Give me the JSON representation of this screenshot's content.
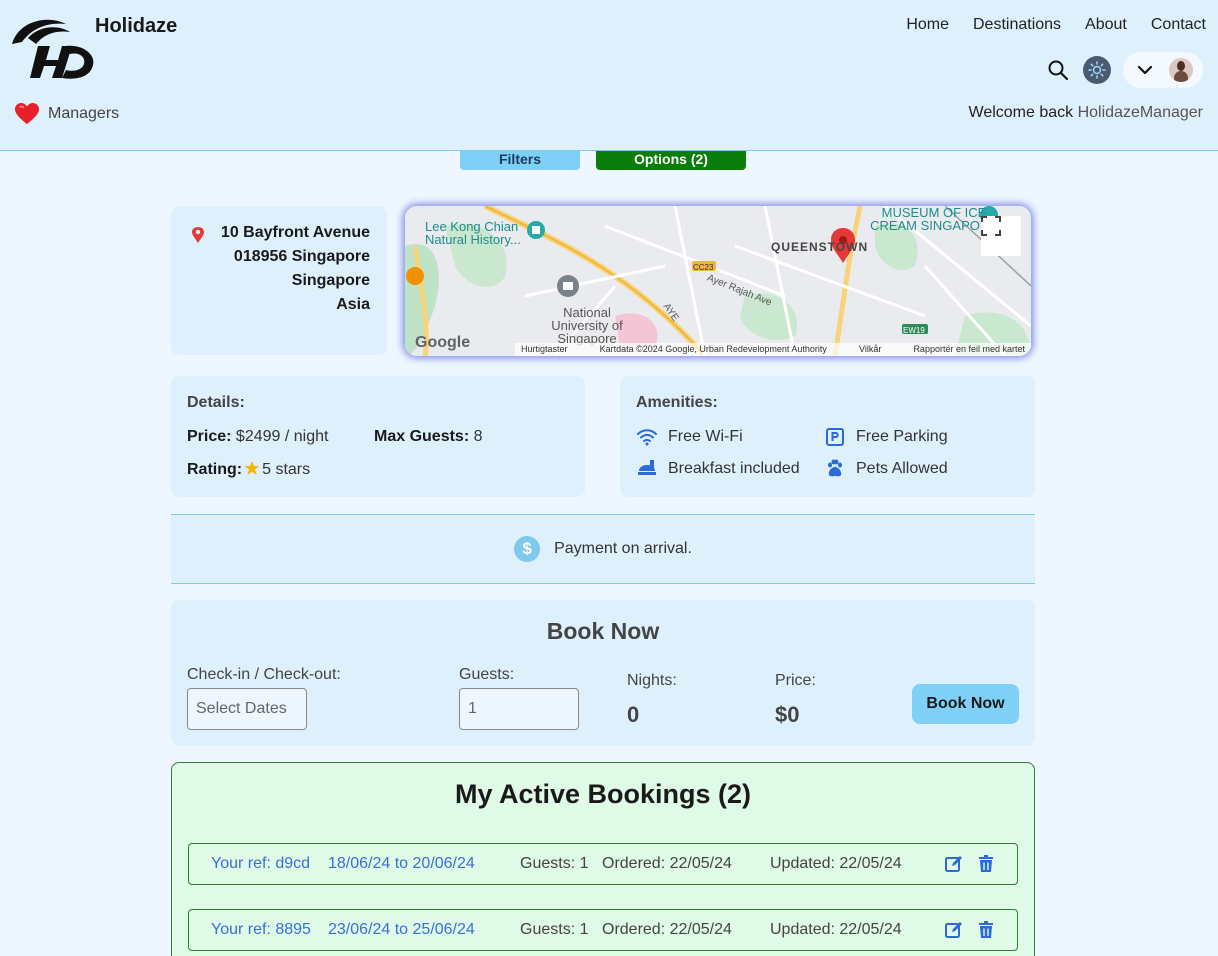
{
  "header": {
    "brand": "Holidaze",
    "nav": [
      "Home",
      "Destinations",
      "About",
      "Contact"
    ],
    "managers_label": "Managers",
    "welcome_prefix": "Welcome back",
    "username": "HolidazeManager",
    "icons": [
      "search-icon",
      "theme-toggle-icon",
      "chevron-down-icon",
      "avatar"
    ]
  },
  "tabs": {
    "filters": "Filters",
    "options": "Options (2)"
  },
  "address": {
    "line1": "10 Bayfront Avenue",
    "line2": "018956 Singapore",
    "line3": "Singapore",
    "line4": "Asia"
  },
  "map": {
    "labels": [
      "Lee Kong Chian Natural History...",
      "MUSEUM OF ICE CREAM SINGAPORE",
      "QUEENSTOWN",
      "National University of Singapore",
      "CC23",
      "EW19",
      "Ayer Rajah Ave",
      "AYE"
    ],
    "attribution": {
      "shortcuts": "Hurtigtaster",
      "data": "Kartdata ©2024 Google, Urban Redevelopment Authority",
      "terms": "Vilkår",
      "report": "Rapportér en feil med kartet"
    },
    "logo": "Google"
  },
  "details": {
    "title": "Details:",
    "price_label": "Price:",
    "price_value": "$2499 / night",
    "max_guests_label": "Max Guests:",
    "max_guests_value": "8",
    "rating_label": "Rating:",
    "rating_value": "5 stars"
  },
  "amenities": {
    "title": "Amenities:",
    "items": [
      {
        "label": "Free Wi-Fi",
        "icon": "wifi-icon"
      },
      {
        "label": "Free Parking",
        "icon": "parking-icon"
      },
      {
        "label": "Breakfast included",
        "icon": "breakfast-icon"
      },
      {
        "label": "Pets Allowed",
        "icon": "paw-icon"
      }
    ]
  },
  "payment": {
    "text": "Payment on arrival.",
    "icon": "$"
  },
  "booking": {
    "title": "Book Now",
    "dates_label": "Check-in / Check-out:",
    "dates_placeholder": "Select Dates",
    "guests_label": "Guests:",
    "guests_value": "1",
    "nights_label": "Nights:",
    "nights_value": "0",
    "price_label": "Price:",
    "price_value": "$0",
    "button": "Book Now"
  },
  "active_bookings": {
    "title": "My Active Bookings (2)",
    "rows": [
      {
        "ref": "Your ref: d9cd",
        "dates": "18/06/24 to 20/06/24",
        "guests": "Guests: 1",
        "ordered": "Ordered: 22/05/24",
        "updated": "Updated: 22/05/24"
      },
      {
        "ref": "Your ref: 8895",
        "dates": "23/06/24 to 25/06/24",
        "guests": "Guests: 1",
        "ordered": "Ordered: 22/05/24",
        "updated": "Updated: 22/05/24"
      }
    ]
  },
  "colors": {
    "header_bg": "#dff0fd",
    "page_bg": "#eef7ff",
    "accent": "#7fd0f7",
    "options_green": "#0a7d0a",
    "bookings_bg": "#dffae6",
    "link_blue": "#3a6fd8"
  }
}
